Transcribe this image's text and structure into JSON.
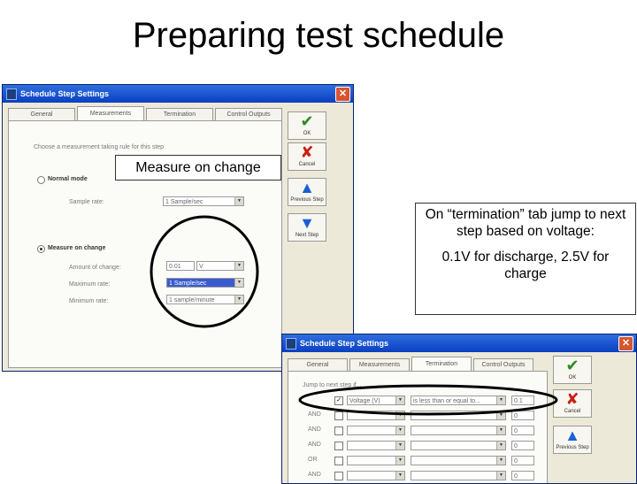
{
  "slide": {
    "title": "Preparing test schedule",
    "callout_measure": "Measure on change",
    "callout_termination_line1": "On “termination” tab jump to next step based on voltage:",
    "callout_termination_line2": "0.1V for discharge, 2.5V for charge"
  },
  "dialog1": {
    "title": "Schedule Step Settings",
    "tabs": [
      "General",
      "Measurements",
      "Termination",
      "Control Outputs"
    ],
    "active_tab": "Measurements",
    "group_heading": "Choose a measurement taking rule for this step",
    "normal_mode_label": "Normal mode",
    "sample_rate_label": "Sample rate:",
    "sample_rate_value": "1 Sample/sec",
    "measure_on_change_label": "Measure on change",
    "amount_of_change_label": "Amount of change:",
    "amount_value": "0.01",
    "amount_unit": "V",
    "maximum_rate_label": "Maximum rate:",
    "maximum_rate_value": "1 Sample/sec",
    "minimum_rate_label": "Minimum rate:",
    "minimum_rate_value": "1 sample/minute",
    "buttons": {
      "ok": "OK",
      "cancel": "Cancel",
      "previous": "Previous Step",
      "next": "Next Step"
    }
  },
  "dialog2": {
    "title": "Schedule Step Settings",
    "tabs": [
      "General",
      "Measurements",
      "Termination",
      "Control Outputs"
    ],
    "active_tab": "Termination",
    "jump_heading": "Jump to next step if...",
    "rows": [
      {
        "logic": "",
        "checked": "✓",
        "field": "Voltage (V)",
        "op": "is less than or equal to...",
        "value": "0.1"
      },
      {
        "logic": "AND",
        "checked": "",
        "field": "",
        "op": "",
        "value": "0"
      },
      {
        "logic": "AND",
        "checked": "",
        "field": "",
        "op": "",
        "value": "0"
      },
      {
        "logic": "AND",
        "checked": "",
        "field": "",
        "op": "",
        "value": "0"
      },
      {
        "logic": "OR",
        "checked": "",
        "field": "",
        "op": "",
        "value": "0"
      },
      {
        "logic": "AND",
        "checked": "",
        "field": "",
        "op": "",
        "value": "0"
      }
    ],
    "buttons": {
      "ok": "OK",
      "cancel": "Cancel",
      "previous": "Previous Step"
    }
  }
}
